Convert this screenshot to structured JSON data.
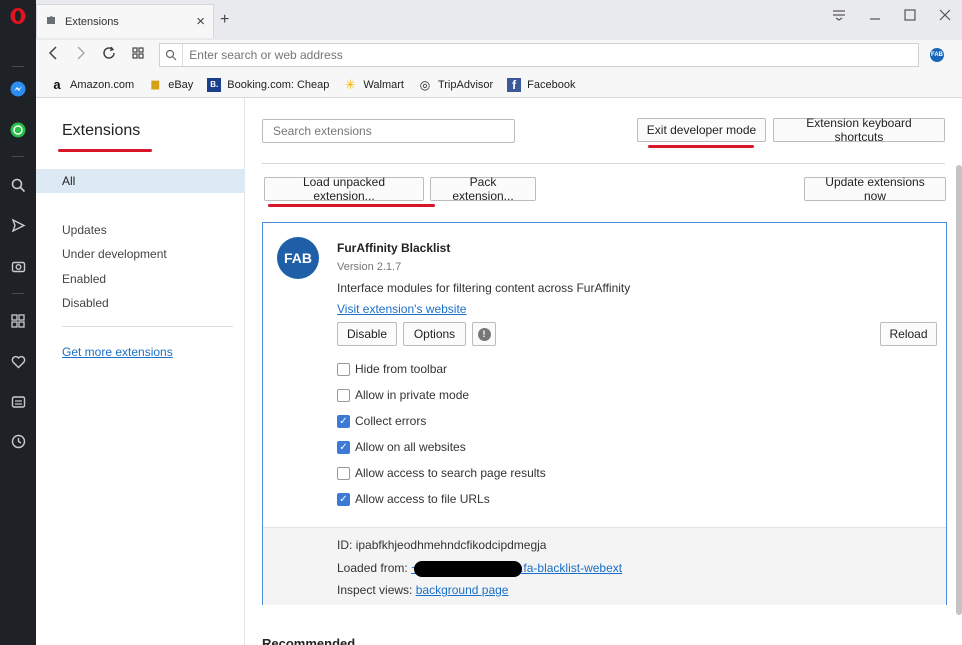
{
  "browser": {
    "tab_title": "Extensions",
    "tab_close": "×",
    "new_tab": "+",
    "address_placeholder": "Enter search or web address",
    "extension_badge": "FAB"
  },
  "bookmarks": [
    {
      "label": "Amazon.com",
      "icon": "a"
    },
    {
      "label": "eBay",
      "icon": "▆"
    },
    {
      "label": "Booking.com: Cheap",
      "icon": "B."
    },
    {
      "label": "Walmart",
      "icon": "✳"
    },
    {
      "label": "TripAdvisor",
      "icon": "◎"
    },
    {
      "label": "Facebook",
      "icon": "f"
    }
  ],
  "sidebar": {
    "title": "Extensions",
    "selected": "All",
    "items": [
      "Updates",
      "Under development",
      "Enabled",
      "Disabled"
    ],
    "link": "Get more extensions"
  },
  "toolbar": {
    "search_placeholder": "Search extensions",
    "exit_dev": "Exit developer mode",
    "shortcuts": "Extension keyboard shortcuts",
    "load_unpacked": "Load unpacked extension...",
    "pack": "Pack extension...",
    "update_now": "Update extensions now"
  },
  "extension": {
    "logo_text": "FAB",
    "name": "FurAffinity Blacklist",
    "version": "Version 2.1.7",
    "description": "Interface modules for filtering content across FurAffinity",
    "website_link": "Visit extension's website",
    "disable": "Disable",
    "options": "Options",
    "warning": "!",
    "reload": "Reload",
    "options_list": [
      {
        "label": "Hide from toolbar",
        "checked": false
      },
      {
        "label": "Allow in private mode",
        "checked": false
      },
      {
        "label": "Collect errors",
        "checked": true
      },
      {
        "label": "Allow on all websites",
        "checked": true
      },
      {
        "label": "Allow access to search page results",
        "checked": false
      },
      {
        "label": "Allow access to file URLs",
        "checked": true
      }
    ],
    "id_label": "ID:",
    "id_value": "ipabfkhjeodhmehndcfikodcipdmegja",
    "loaded_label": "Loaded from:",
    "loaded_prefix": "~",
    "loaded_suffix": ".fa-blacklist-webext",
    "inspect_label": "Inspect views:",
    "inspect_link": "background page"
  },
  "recommended_heading": "Recommended",
  "colors": {
    "accent": "#1a6fc9",
    "annotation_red": "#d8152a",
    "checkbox_blue": "#3d7ad6"
  }
}
